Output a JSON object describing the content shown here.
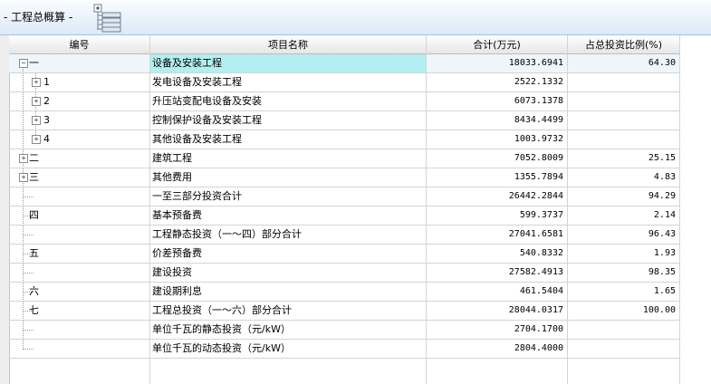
{
  "panel": {
    "title": "- 工程总概算 -",
    "tree_icon": "tree-structure-icon"
  },
  "table": {
    "columns": [
      "编号",
      "项目名称",
      "合计(万元)",
      "占总投资比例(%)"
    ],
    "rows": [
      {
        "expander": "−",
        "code": "一",
        "name": "设备及安装工程",
        "total": "18033.6941",
        "pct": "64.30",
        "selected": true
      },
      {
        "expander": "+",
        "code": "1",
        "name": "发电设备及安装工程",
        "total": "2522.1332",
        "pct": ""
      },
      {
        "expander": "+",
        "code": "2",
        "name": "升压站变配电设备及安装",
        "total": "6073.1378",
        "pct": ""
      },
      {
        "expander": "+",
        "code": "3",
        "name": "控制保护设备及安装工程",
        "total": "8434.4499",
        "pct": ""
      },
      {
        "expander": "+",
        "code": "4",
        "name": "其他设备及安装工程",
        "total": "1003.9732",
        "pct": ""
      },
      {
        "expander": "+",
        "code": "二",
        "name": "建筑工程",
        "total": "7052.8009",
        "pct": "25.15"
      },
      {
        "expander": "+",
        "code": "三",
        "name": "其他费用",
        "total": "1355.7894",
        "pct": "4.83"
      },
      {
        "expander": "",
        "code": "",
        "name": "一至三部分投资合计",
        "total": "26442.2844",
        "pct": "94.29"
      },
      {
        "expander": "",
        "code": "四",
        "name": "基本预备费",
        "total": "599.3737",
        "pct": "2.14"
      },
      {
        "expander": "",
        "code": "",
        "name": "工程静态投资（一～四）部分合计",
        "total": "27041.6581",
        "pct": "96.43"
      },
      {
        "expander": "",
        "code": "五",
        "name": "价差预备费",
        "total": "540.8332",
        "pct": "1.93"
      },
      {
        "expander": "",
        "code": "",
        "name": "建设投资",
        "total": "27582.4913",
        "pct": "98.35"
      },
      {
        "expander": "",
        "code": "六",
        "name": "建设期利息",
        "total": "461.5404",
        "pct": "1.65"
      },
      {
        "expander": "",
        "code": "七",
        "name": "工程总投资（一～六）部分合计",
        "total": "28044.0317",
        "pct": "100.00"
      },
      {
        "expander": "",
        "code": "",
        "name": "单位千瓦的静态投资（元/kW）",
        "total": "2704.1700",
        "pct": ""
      },
      {
        "expander": "",
        "code": "",
        "name": "单位千瓦的动态投资（元/kW）",
        "total": "2804.4000",
        "pct": ""
      }
    ]
  }
}
